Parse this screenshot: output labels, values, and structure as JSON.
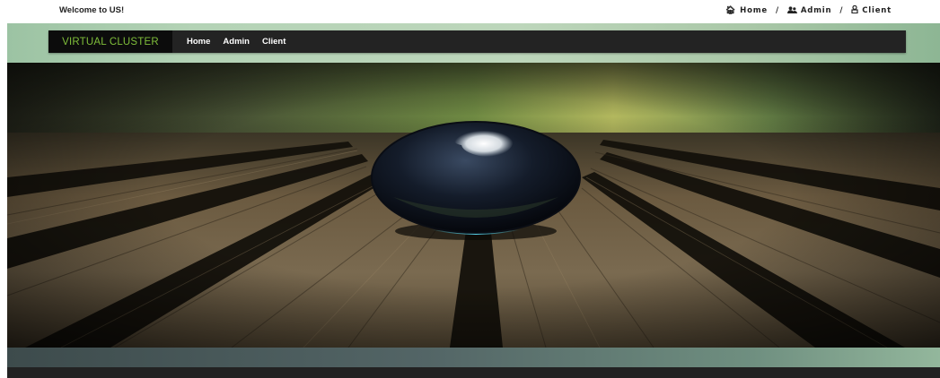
{
  "topbar": {
    "welcome": "Welcome to US!",
    "links": [
      {
        "label": "Home",
        "icon": "home-icon"
      },
      {
        "label": "Admin",
        "icon": "users-icon"
      },
      {
        "label": "Client",
        "icon": "user-icon"
      }
    ],
    "separator": "/"
  },
  "navbar": {
    "brand": "VIRTUAL CLUSTER",
    "brand_color": "#7fbe3a",
    "items": [
      "Home",
      "Admin",
      "Client"
    ]
  },
  "hero": {
    "image": "glass-sphere-on-wooden-deck"
  }
}
